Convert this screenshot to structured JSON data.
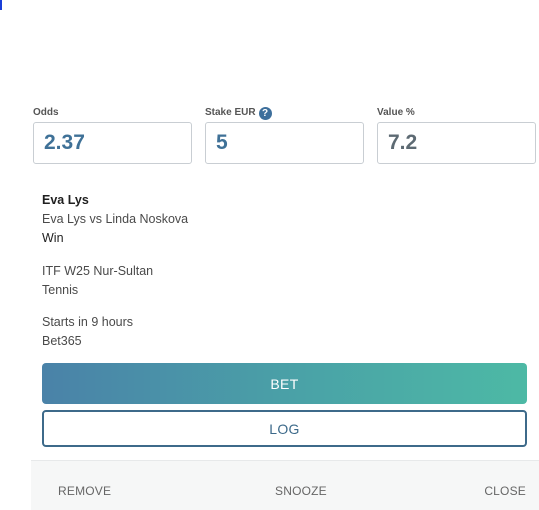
{
  "inputs": {
    "odds": {
      "label": "Odds",
      "value": "2.37"
    },
    "stake": {
      "label": "Stake EUR",
      "value": "5",
      "help_icon": "question-circle-icon",
      "help_glyph": "?"
    },
    "value_pct": {
      "label": "Value %",
      "value": "7.2"
    }
  },
  "selection": {
    "player": "Eva Lys",
    "match": "Eva Lys vs Linda Noskova",
    "market": "Win"
  },
  "event": {
    "tournament": "ITF W25 Nur-Sultan",
    "sport": "Tennis"
  },
  "timing": {
    "starts": "Starts in 9 hours",
    "bookmaker": "Bet365"
  },
  "actions": {
    "bet_label": "BET",
    "log_label": "LOG"
  },
  "footer": {
    "remove_label": "REMOVE",
    "snooze_label": "SNOOZE",
    "close_label": "CLOSE"
  },
  "colors": {
    "accent_blue": "#3f7197",
    "gradient_start": "#4a82a8",
    "gradient_end": "#4db9a5",
    "log_border": "#3d6a8a"
  }
}
